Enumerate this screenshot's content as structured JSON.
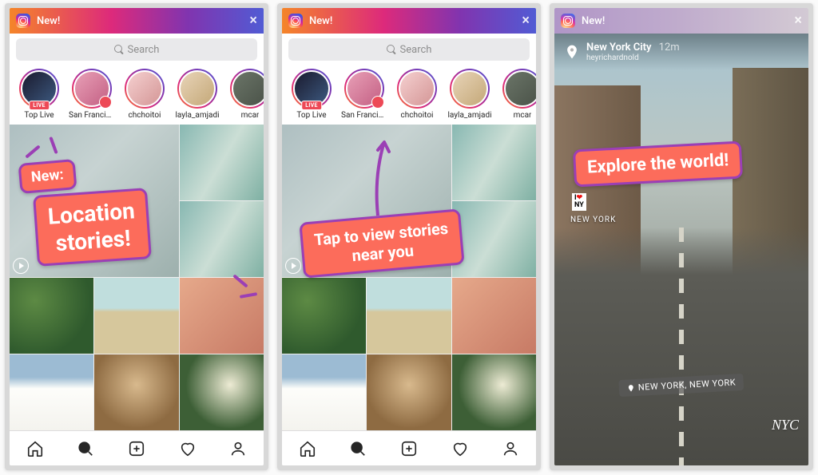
{
  "banner": {
    "label": "New!"
  },
  "search": {
    "placeholder": "Search"
  },
  "stories": [
    {
      "label": "Top Live",
      "live": true,
      "live_text": "LIVE",
      "avatar_bg": "linear-gradient(135deg,#1a1a2e,#3d5a80)"
    },
    {
      "label": "San Francisco",
      "pin": true,
      "avatar_bg": "linear-gradient(135deg,#e8a0b7,#c46084)"
    },
    {
      "label": "chchoitoi",
      "avatar_bg": "linear-gradient(135deg,#f5d0d0,#d49696)"
    },
    {
      "label": "layla_amjadi",
      "avatar_bg": "linear-gradient(135deg,#e8d4b8,#c4a878)"
    },
    {
      "label": "mcar",
      "avatar_bg": "linear-gradient(135deg,#6b7568,#4a5248)"
    }
  ],
  "panel1": {
    "new_badge": "New:",
    "headline": "Location\nstories!"
  },
  "panel2": {
    "headline": "Tap to view stories\nnear you"
  },
  "panel3": {
    "location_title": "New York City",
    "location_time": "12m",
    "user": "heyrichardnold",
    "headline": "Explore the world!",
    "chip": "NEW YORK, NEW YORK",
    "handwritten": "NYC",
    "iny_top": "I",
    "iny_heart": "❤",
    "iny_bot": "NY",
    "ny_label": "NEW YORK"
  }
}
